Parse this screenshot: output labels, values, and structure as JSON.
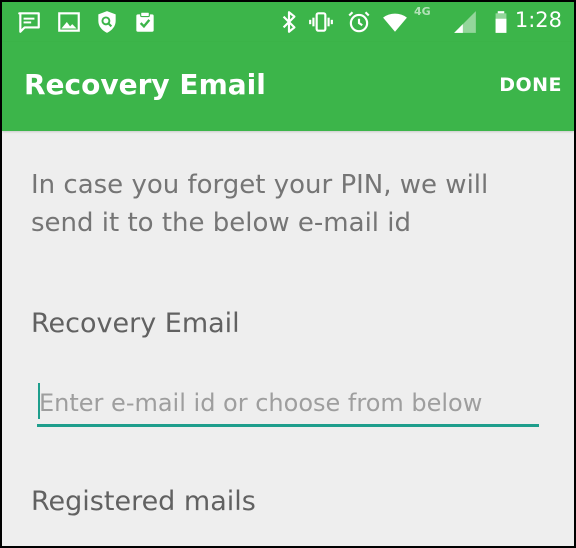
{
  "status_bar": {
    "background": "#3cb54a",
    "left_icons": [
      "message-icon",
      "image-icon",
      "security-shield-icon",
      "clipboard-check-icon"
    ],
    "right_icons": [
      "bluetooth-icon",
      "vibrate-icon",
      "alarm-icon",
      "wifi-icon",
      "signal-icon",
      "battery-icon"
    ],
    "network_label": "4G",
    "time": "1:28"
  },
  "app_bar": {
    "title": "Recovery Email",
    "done_label": "DONE",
    "color": "#3cb54a"
  },
  "content": {
    "description": "In case you forget your PIN, we will send it to the below e-mail id",
    "recovery_label": "Recovery Email",
    "email_input": {
      "value": "",
      "placeholder": "Enter e-mail id or choose from below",
      "accent": "#1e9e8c"
    },
    "registered_label": "Registered mails"
  }
}
